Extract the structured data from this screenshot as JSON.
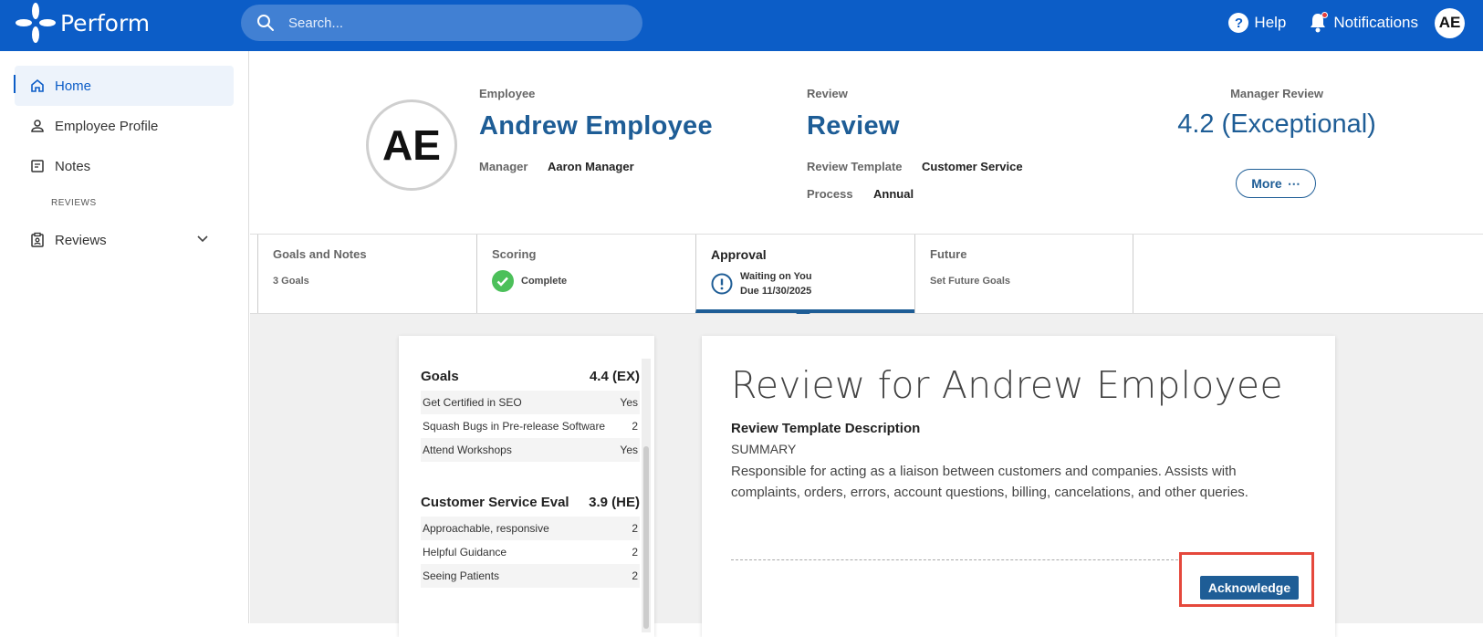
{
  "app": {
    "name": "Perform"
  },
  "search": {
    "placeholder": "Search..."
  },
  "topnav": {
    "help": "Help",
    "notifications": "Notifications",
    "user_initials": "AE"
  },
  "sidebar": {
    "items": [
      {
        "label": "Home",
        "icon": "home-icon",
        "active": true
      },
      {
        "label": "Employee Profile",
        "icon": "person-icon"
      },
      {
        "label": "Notes",
        "icon": "notes-icon"
      }
    ],
    "section_label": "REVIEWS",
    "reviews": {
      "label": "Reviews",
      "icon": "reviews-icon"
    }
  },
  "header": {
    "avatar_initials": "AE",
    "employee_label": "Employee",
    "employee_name": "Andrew Employee",
    "manager_label": "Manager",
    "manager_name": "Aaron Manager",
    "review_label": "Review",
    "review_title": "Review",
    "template_label": "Review Template",
    "template_value": "Customer Service",
    "process_label": "Process",
    "process_value": "Annual",
    "manager_review_label": "Manager Review",
    "manager_review_score": "4.2 (Exceptional)",
    "more_label": "More",
    "more_icon": "ellipsis-icon"
  },
  "tabs": [
    {
      "title": "Goals and Notes",
      "sub": "3 Goals"
    },
    {
      "title": "Scoring",
      "status": "Complete",
      "icon": "check-circle-icon"
    },
    {
      "title": "Approval",
      "status_line1": "Waiting on You",
      "status_line2": "Due 11/30/2025",
      "icon": "alert-circle-icon",
      "active": true
    },
    {
      "title": "Future",
      "sub": "Set Future Goals"
    }
  ],
  "scores": {
    "goals": {
      "title": "Goals",
      "score": "4.4 (EX)",
      "rows": [
        {
          "label": "Get Certified in SEO",
          "value": "Yes"
        },
        {
          "label": "Squash Bugs in Pre-release Software",
          "value": "2"
        },
        {
          "label": "Attend Workshops",
          "value": "Yes"
        }
      ]
    },
    "eval": {
      "title": "Customer Service Eval",
      "score": "3.9 (HE)",
      "rows": [
        {
          "label": "Approachable, responsive",
          "value": "2"
        },
        {
          "label": "Helpful Guidance",
          "value": "2"
        },
        {
          "label": "Seeing Patients",
          "value": "2"
        }
      ]
    }
  },
  "review": {
    "title": "Review for Andrew Employee",
    "desc_heading": "Review Template Description",
    "summary_label": "SUMMARY",
    "description": "Responsible for acting as a liaison between customers and companies. Assists with complaints, orders, errors, account questions, billing, cancelations, and other queries.",
    "acknowledge_label": "Acknowledge"
  },
  "colors": {
    "brand": "#0c5dc7",
    "accent": "#1e5d96",
    "complete": "#4cc05a",
    "highlight": "#e5483c"
  }
}
